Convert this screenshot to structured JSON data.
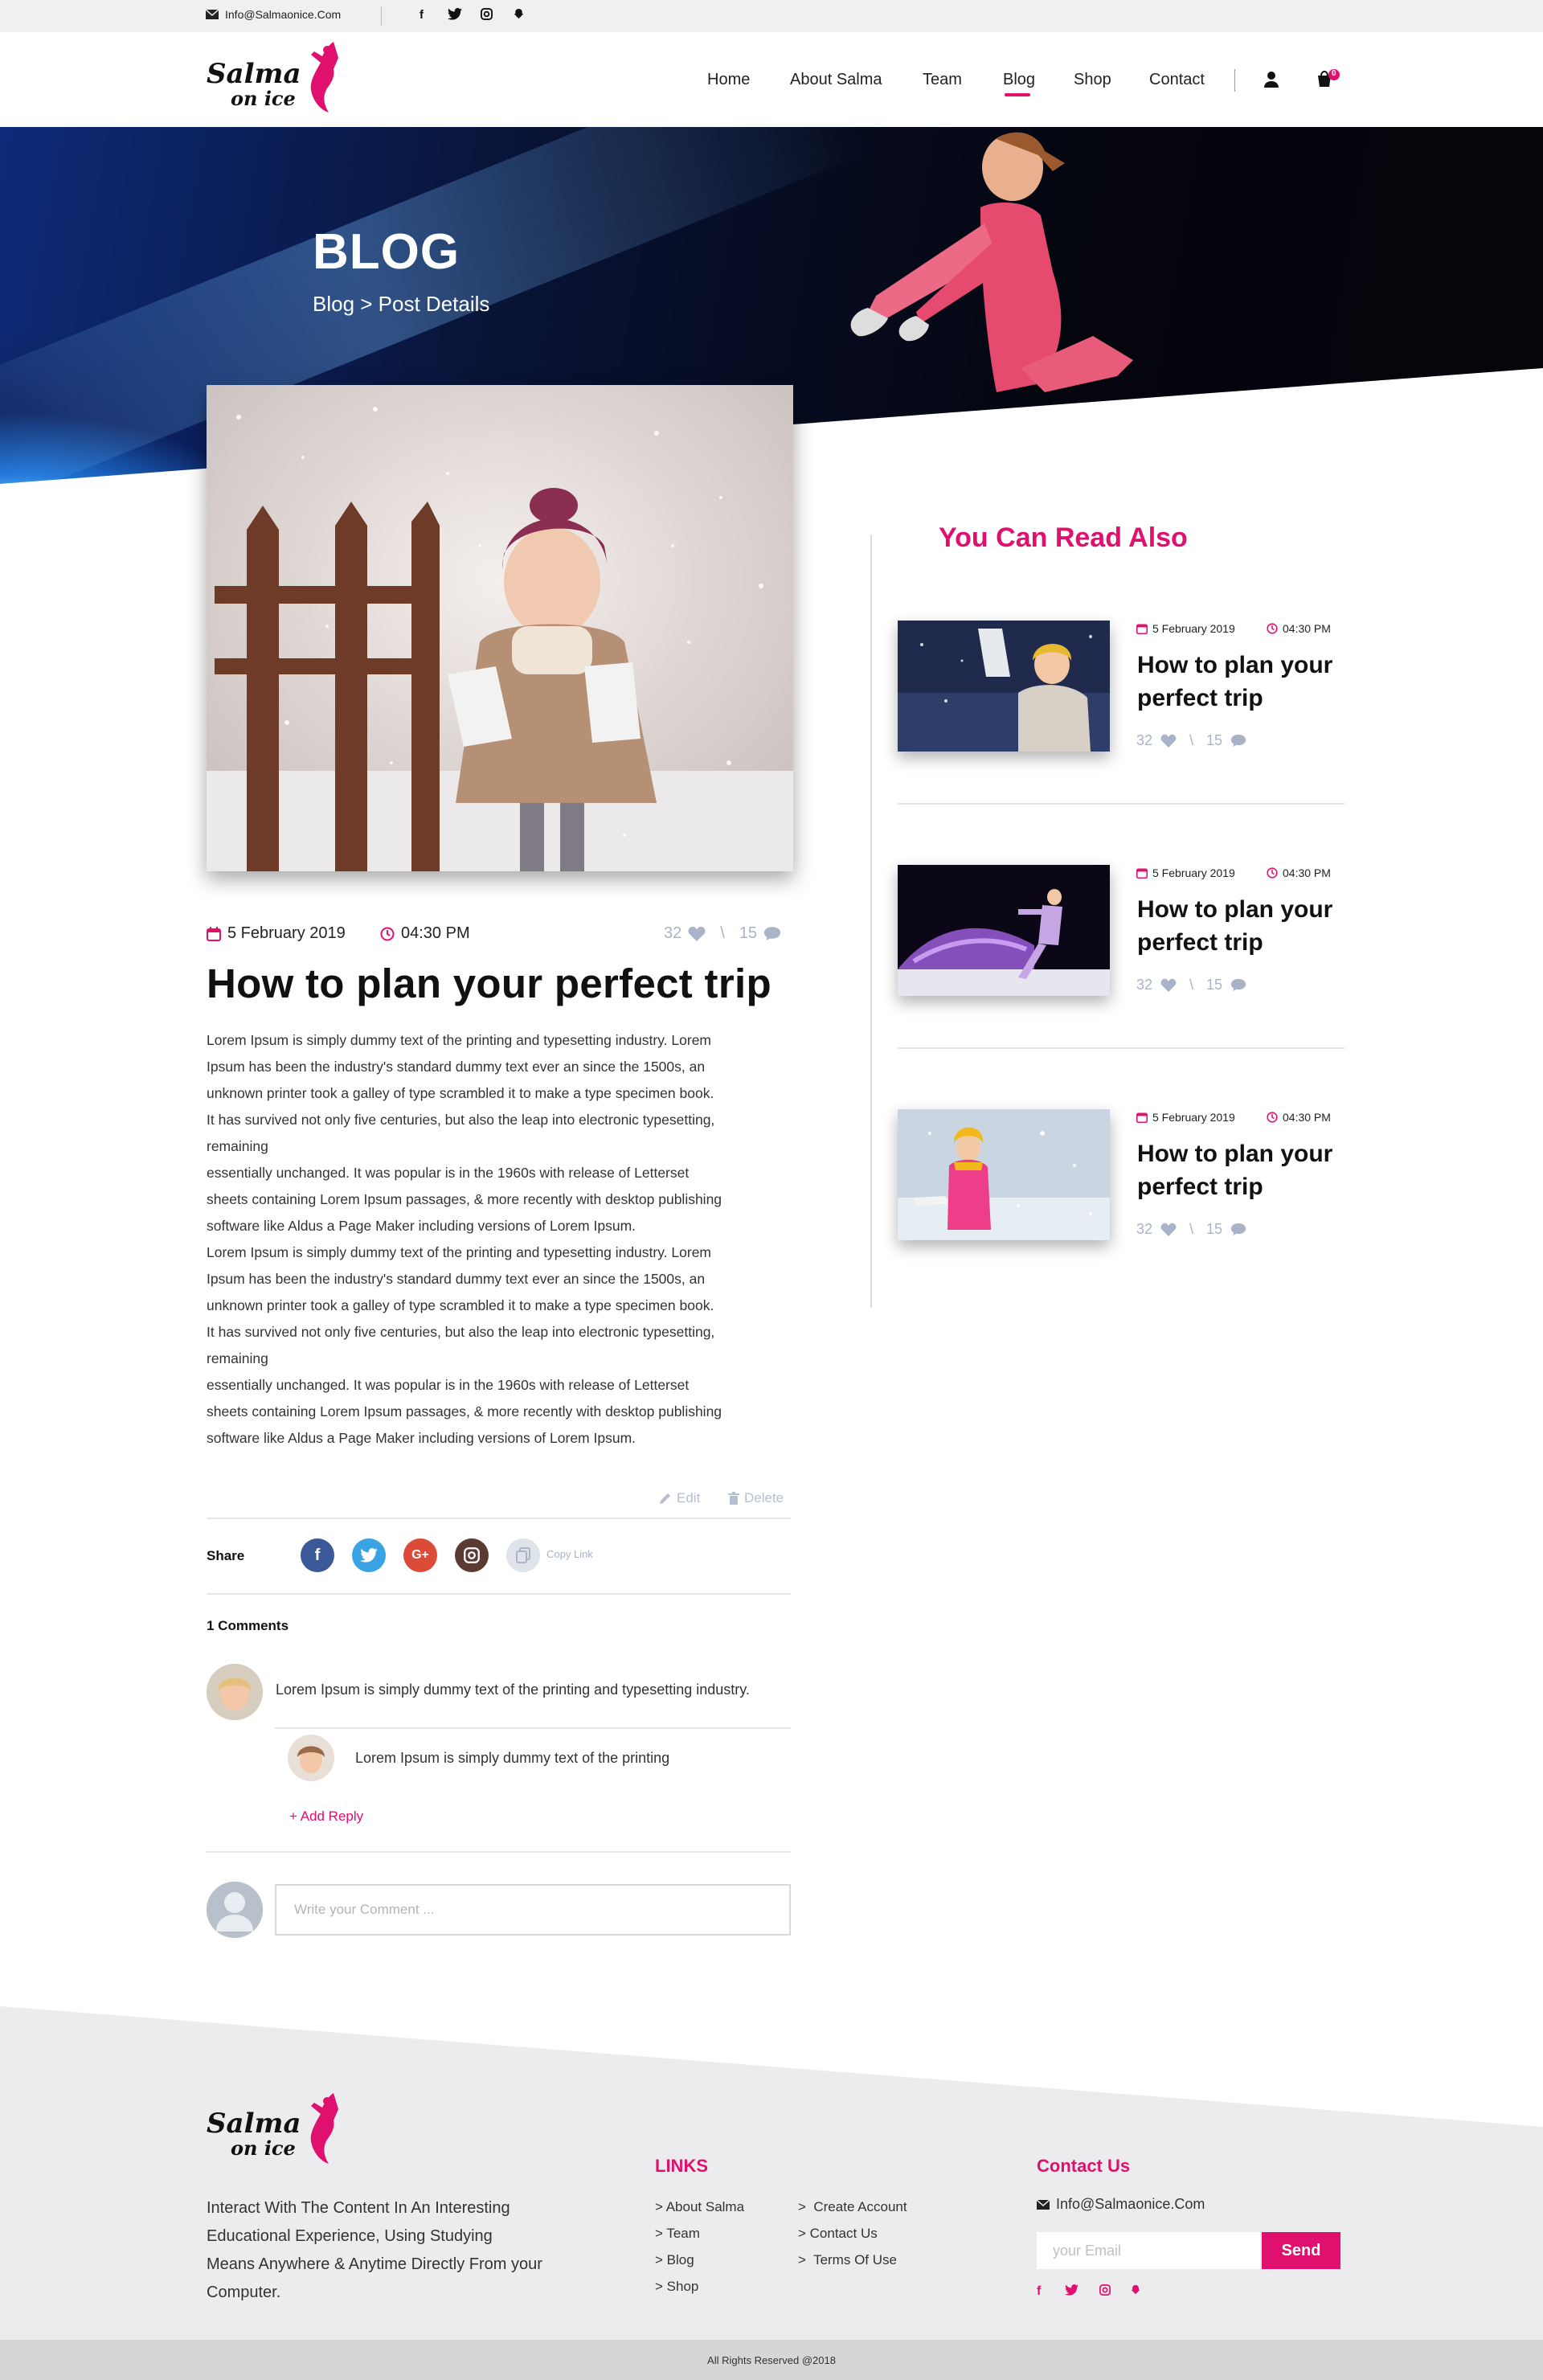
{
  "topbar": {
    "email": "Info@Salmaonice.Com",
    "social": [
      "f",
      "t",
      "ig",
      "sc"
    ]
  },
  "brand": {
    "line1": "Salma",
    "line2": "on ice"
  },
  "nav": {
    "items": [
      "Home",
      "About Salma",
      "Team",
      "Blog",
      "Shop",
      "Contact"
    ],
    "active": "Blog",
    "cart_count": "0"
  },
  "hero": {
    "title": "BLOG",
    "breadcrumb": "Blog > Post Details"
  },
  "post": {
    "date": "5 February 2019",
    "time": "04:30 PM",
    "likes": "32",
    "divider": "\\",
    "comments": "15",
    "title": "How to plan your perfect trip",
    "body": "Lorem Ipsum is simply dummy text of the printing and typesetting industry. Lorem\nIpsum has been the industry's standard dummy text ever an since the 1500s, an\nunknown printer took a galley of type scrambled it to make a type specimen book.\nIt has survived not only  five centuries, but also the leap into electronic typesetting,\nremaining\nessentially unchanged. It was popular is in the 1960s with release of Letterset\nsheets containing Lorem Ipsum passages, & more recently with desktop publishing\nsoftware like Aldus a Page Maker including versions of Lorem Ipsum.\nLorem Ipsum is simply dummy text of the printing and typesetting industry. Lorem\nIpsum has been the industry's standard dummy text ever an since the 1500s, an\nunknown printer took a galley of type scrambled it to make a type specimen book.\nIt has survived not only  five centuries, but also the leap into electronic typesetting,\nremaining\nessentially unchanged. It was popular is in the 1960s with release of Letterset\nsheets containing Lorem Ipsum passages, & more recently with desktop publishing\nsoftware like Aldus a Page Maker including versions of Lorem Ipsum.",
    "edit_label": "Edit",
    "delete_label": "Delete"
  },
  "share": {
    "label": "Share",
    "buttons": [
      {
        "name": "facebook",
        "glyph": "f",
        "color": "#3b5998"
      },
      {
        "name": "twitter",
        "glyph": "t",
        "color": "#3aa3e3"
      },
      {
        "name": "google-plus",
        "glyph": "G+",
        "color": "#dc4a38"
      },
      {
        "name": "instagram",
        "glyph": "◎",
        "color": "#5a3a33"
      }
    ],
    "copy_label": "Copy Link"
  },
  "comments": {
    "count_label": "1 Comments",
    "main_text": "Lorem Ipsum is simply dummy text of the printing and typesetting industry.",
    "reply_text": "Lorem Ipsum is simply dummy text of the printing",
    "add_reply": "+ Add Reply",
    "input_placeholder": "Write your Comment ..."
  },
  "sidebar": {
    "heading": "You Can Read Also",
    "cards": [
      {
        "date": "5 February 2019",
        "time": "04:30 PM",
        "title": "How to plan your perfect trip",
        "likes": "32",
        "divider": "\\",
        "comments": "15"
      },
      {
        "date": "5 February 2019",
        "time": "04:30 PM",
        "title": "How to plan your perfect trip",
        "likes": "32",
        "divider": "\\",
        "comments": "15"
      },
      {
        "date": "5 February 2019",
        "time": "04:30 PM",
        "title": "How to plan your perfect trip",
        "likes": "32",
        "divider": "\\",
        "comments": "15"
      }
    ]
  },
  "footer": {
    "description": "Interact With The Content In An Interesting Educational Experience, Using Studying Means Anywhere & Anytime Directly From your Computer.",
    "links_heading": "LINKS",
    "links_col1": [
      "> About Salma",
      "> Team",
      "> Blog",
      "> Shop"
    ],
    "links_col2": [
      ">  Create Account",
      "> Contact Us",
      ">  Terms Of Use"
    ],
    "contact_heading": "Contact Us",
    "contact_email": "Info@Salmaonice.Com",
    "email_placeholder": "your Email",
    "send_label": "Send",
    "copyright": "All Rights Reserved @2018"
  },
  "colors": {
    "accent": "#e0106f",
    "muted": "#a9b4c9"
  }
}
